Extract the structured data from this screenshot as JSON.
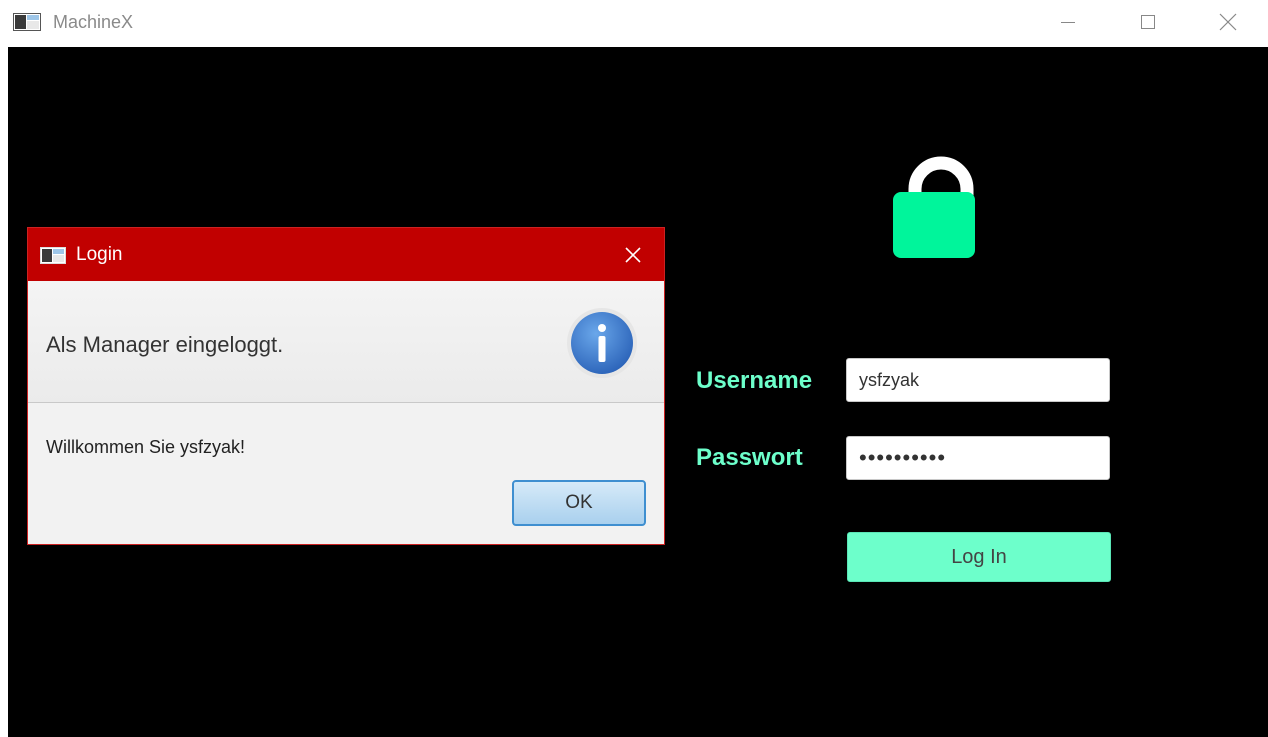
{
  "window": {
    "title": "MachineX",
    "minimize_icon": "minimize-icon",
    "maximize_icon": "maximize-icon",
    "close_icon": "close-icon"
  },
  "login_form": {
    "lock_icon": "lock-icon",
    "username_label": "Username",
    "username_value": "ysfzyak",
    "password_label": "Passwort",
    "password_masked": "••••••••••",
    "login_button": "Log In",
    "accent_color": "#6dffcb"
  },
  "dialog": {
    "title": "Login",
    "header_text": "Als Manager eingeloggt.",
    "info_icon": "info-icon",
    "message": "Willkommen Sie ysfzyak!",
    "ok_button": "OK",
    "titlebar_color": "#c10000"
  }
}
